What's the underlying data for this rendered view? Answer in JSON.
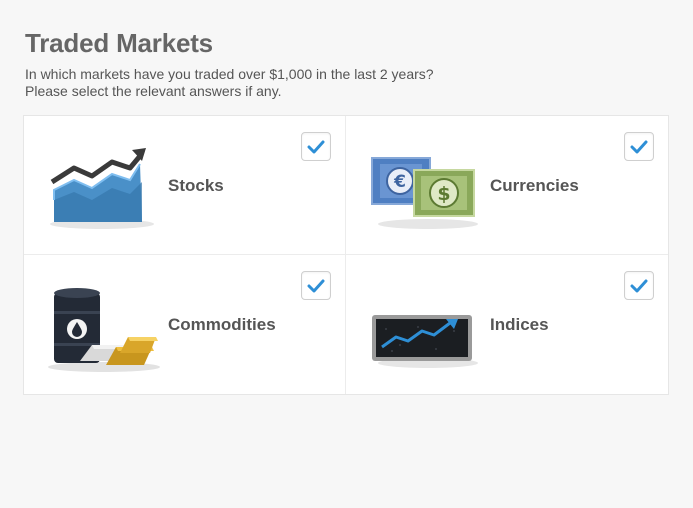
{
  "header": {
    "title": "Traded Markets",
    "subtitle_line1": "In which markets have you traded over $1,000 in the last 2 years?",
    "subtitle_line2": "Please select the relevant answers if any."
  },
  "markets": [
    {
      "label": "Stocks",
      "checked": true,
      "icon": "stocks-chart-icon"
    },
    {
      "label": "Currencies",
      "checked": true,
      "icon": "currency-notes-icon"
    },
    {
      "label": "Commodities",
      "checked": true,
      "icon": "oil-barrel-gold-icon"
    },
    {
      "label": "Indices",
      "checked": true,
      "icon": "index-monitor-icon"
    }
  ],
  "colors": {
    "check": "#2e8fd6",
    "title": "#666666",
    "label": "#555555"
  }
}
